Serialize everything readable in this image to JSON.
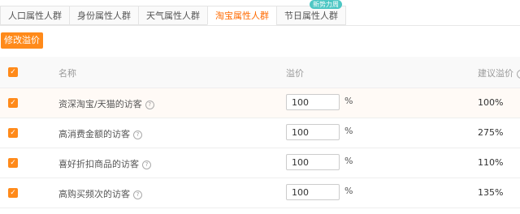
{
  "tabs": [
    {
      "label": "人口属性人群",
      "active": false
    },
    {
      "label": "身份属性人群",
      "active": false
    },
    {
      "label": "天气属性人群",
      "active": false
    },
    {
      "label": "淘宝属性人群",
      "active": true
    },
    {
      "label": "节日属性人群",
      "active": false,
      "badge": "新势力周"
    }
  ],
  "toolbar": {
    "modify_label": "修改溢价"
  },
  "table": {
    "headers": {
      "name": "名称",
      "price": "溢价",
      "suggest": "建议溢价"
    },
    "rows": [
      {
        "name": "资深淘宝/天猫的访客",
        "price": "100",
        "unit": "%",
        "suggest": "100%"
      },
      {
        "name": "高消费金额的访客",
        "price": "100",
        "unit": "%",
        "suggest": "275%"
      },
      {
        "name": "喜好折扣商品的访客",
        "price": "100",
        "unit": "%",
        "suggest": "110%"
      },
      {
        "name": "高购买频次的访客",
        "price": "100",
        "unit": "%",
        "suggest": "135%"
      }
    ]
  },
  "icons": {
    "help": "question-circle-icon",
    "check": "checkbox-checked-icon"
  },
  "colors": {
    "accent": "#ff8a1a",
    "active_tab": "#ff6a00",
    "badge": "#4ec7c4"
  }
}
